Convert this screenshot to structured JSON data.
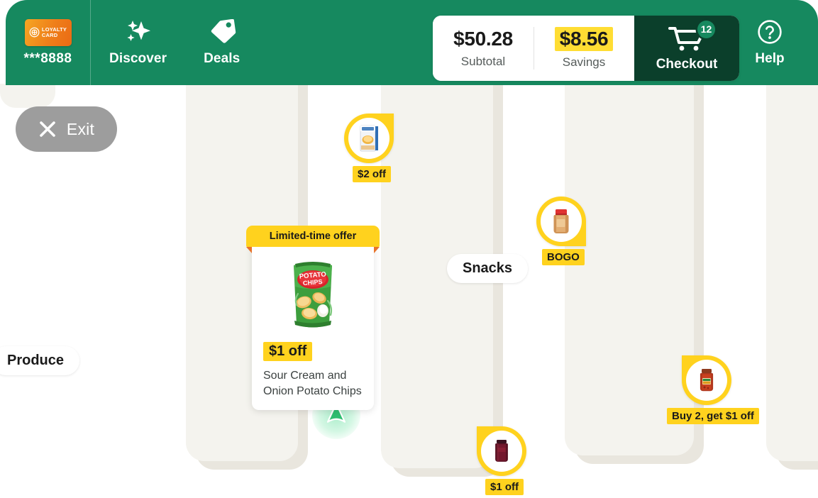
{
  "header": {
    "loyalty": {
      "card_line1": "LOYALTY",
      "card_line2": "CARD",
      "icon": "loyalty-target-icon",
      "digits": "***8888"
    },
    "nav": [
      {
        "id": "discover",
        "label": "Discover",
        "icon": "sparkles-icon"
      },
      {
        "id": "deals",
        "label": "Deals",
        "icon": "price-tag-icon"
      }
    ],
    "summary": [
      {
        "id": "subtotal",
        "amount": "$50.28",
        "label": "Subtotal",
        "highlight": false
      },
      {
        "id": "savings",
        "amount": "$8.56",
        "label": "Savings",
        "highlight": true
      }
    ],
    "checkout": {
      "label": "Checkout",
      "icon": "shopping-cart-icon",
      "badge_count": "12"
    },
    "help": {
      "label": "Help",
      "icon": "question-circle-icon"
    },
    "colors": {
      "brand_green": "#16895f",
      "checkout_green": "#0b3f2b",
      "accent_yellow": "#ffd21e"
    }
  },
  "exit_button": {
    "label": "Exit",
    "icon": "close-x-icon"
  },
  "map": {
    "section_labels": [
      {
        "id": "produce",
        "label": "Produce"
      },
      {
        "id": "snacks",
        "label": "Snacks"
      }
    ],
    "user_location": {
      "icon": "navigation-arrow-icon"
    },
    "pins": [
      {
        "id": "cereal",
        "label": "$2 off",
        "product": "cereal-box-icon",
        "notch": "ne"
      },
      {
        "id": "peanut-butter",
        "label": "BOGO",
        "product": "peanut-butter-jar-icon",
        "notch": "se"
      },
      {
        "id": "salsa",
        "label": "Buy 2, get $1 off",
        "product": "salsa-jar-icon",
        "notch": "nw"
      },
      {
        "id": "jam",
        "label": "$1 off",
        "product": "jam-jar-icon",
        "notch": "nw"
      }
    ]
  },
  "offer_card": {
    "ribbon": "Limited-time offer",
    "discount": "$1 off",
    "product_name": "Sour Cream and Onion Potato Chips",
    "product_icon": "potato-chips-bag-icon"
  }
}
